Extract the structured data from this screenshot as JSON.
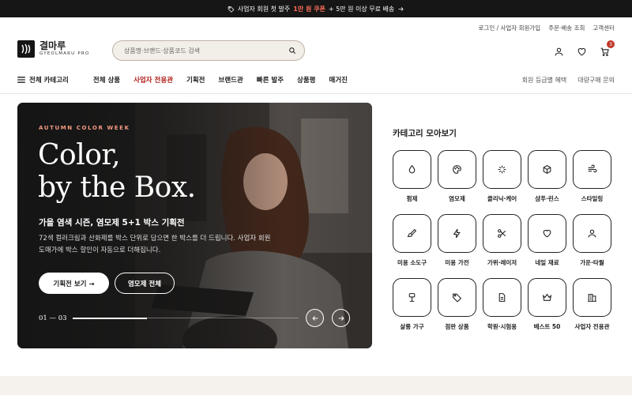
{
  "announcement": {
    "pre": "사업자 회원 첫 발주",
    "highlight": "1만 원 쿠폰",
    "post": "+ 5만 원 이상 무료 배송"
  },
  "utility_links": [
    "로그인 / 사업자 회원가입",
    "주문·배송 조회",
    "고객센터"
  ],
  "logo": {
    "name": "결마루",
    "sub": "GYEOLMARU PRO"
  },
  "search": {
    "placeholder": "상품명·브랜드·상품코드 검색"
  },
  "header_icons": {
    "account": "user-icon",
    "wishlist": "heart-icon",
    "cart": "cart-icon",
    "cart_count": "3"
  },
  "nav": {
    "all_categories": "전체 카테고리",
    "items": [
      "전체 상품",
      "사업자 전용관",
      "기획전",
      "브랜드관",
      "빠른 발주",
      "상품평",
      "매거진"
    ],
    "active_index": 1,
    "right_links": [
      "회원 등급별 혜택",
      "대량구매 문의"
    ]
  },
  "hero": {
    "eyebrow": "AUTUMN COLOR WEEK",
    "headline_line1": "Color,",
    "headline_line2": "by the Box.",
    "subtitle": "가을 염색 시즌, 염모제 5+1 박스 기획전",
    "description": "72색 컬러크림과 산화제를 박스 단위로 담으면 한 박스를 더 드립니다. 사업자 회원 도매가에 박스 할인이 자동으로 더해집니다.",
    "primary_button": "기획전 보기 →",
    "secondary_button": "염모제 전체",
    "slide_counter": "01 — 03",
    "progress": 0.33
  },
  "categories": {
    "title": "카테고리 모아보기",
    "items": [
      {
        "label": "펌제",
        "icon": "droplet-icon"
      },
      {
        "label": "염모제",
        "icon": "palette-icon"
      },
      {
        "label": "클리닉·케어",
        "icon": "sparkle-icon"
      },
      {
        "label": "샴푸·린스",
        "icon": "box-icon"
      },
      {
        "label": "스타일링",
        "icon": "wind-icon"
      },
      {
        "label": "미용 소도구",
        "icon": "brush-icon"
      },
      {
        "label": "미용 가전",
        "icon": "lightning-icon"
      },
      {
        "label": "가위·레이저",
        "icon": "scissors-icon"
      },
      {
        "label": "네일 재료",
        "icon": "heart-icon"
      },
      {
        "label": "가운·타월",
        "icon": "person-icon"
      },
      {
        "label": "살롱 가구",
        "icon": "chair-icon"
      },
      {
        "label": "점판 상품",
        "icon": "tag-icon"
      },
      {
        "label": "학원·시험용",
        "icon": "document-icon"
      },
      {
        "label": "베스트 50",
        "icon": "crown-icon"
      },
      {
        "label": "사업자 전용관",
        "icon": "building-icon"
      }
    ]
  },
  "colors": {
    "accent": "#b0201c",
    "topbar": "#161616",
    "coupon": "#ff6e5a",
    "eyebrow": "#f49a82",
    "search_bg": "#f2eee8"
  }
}
